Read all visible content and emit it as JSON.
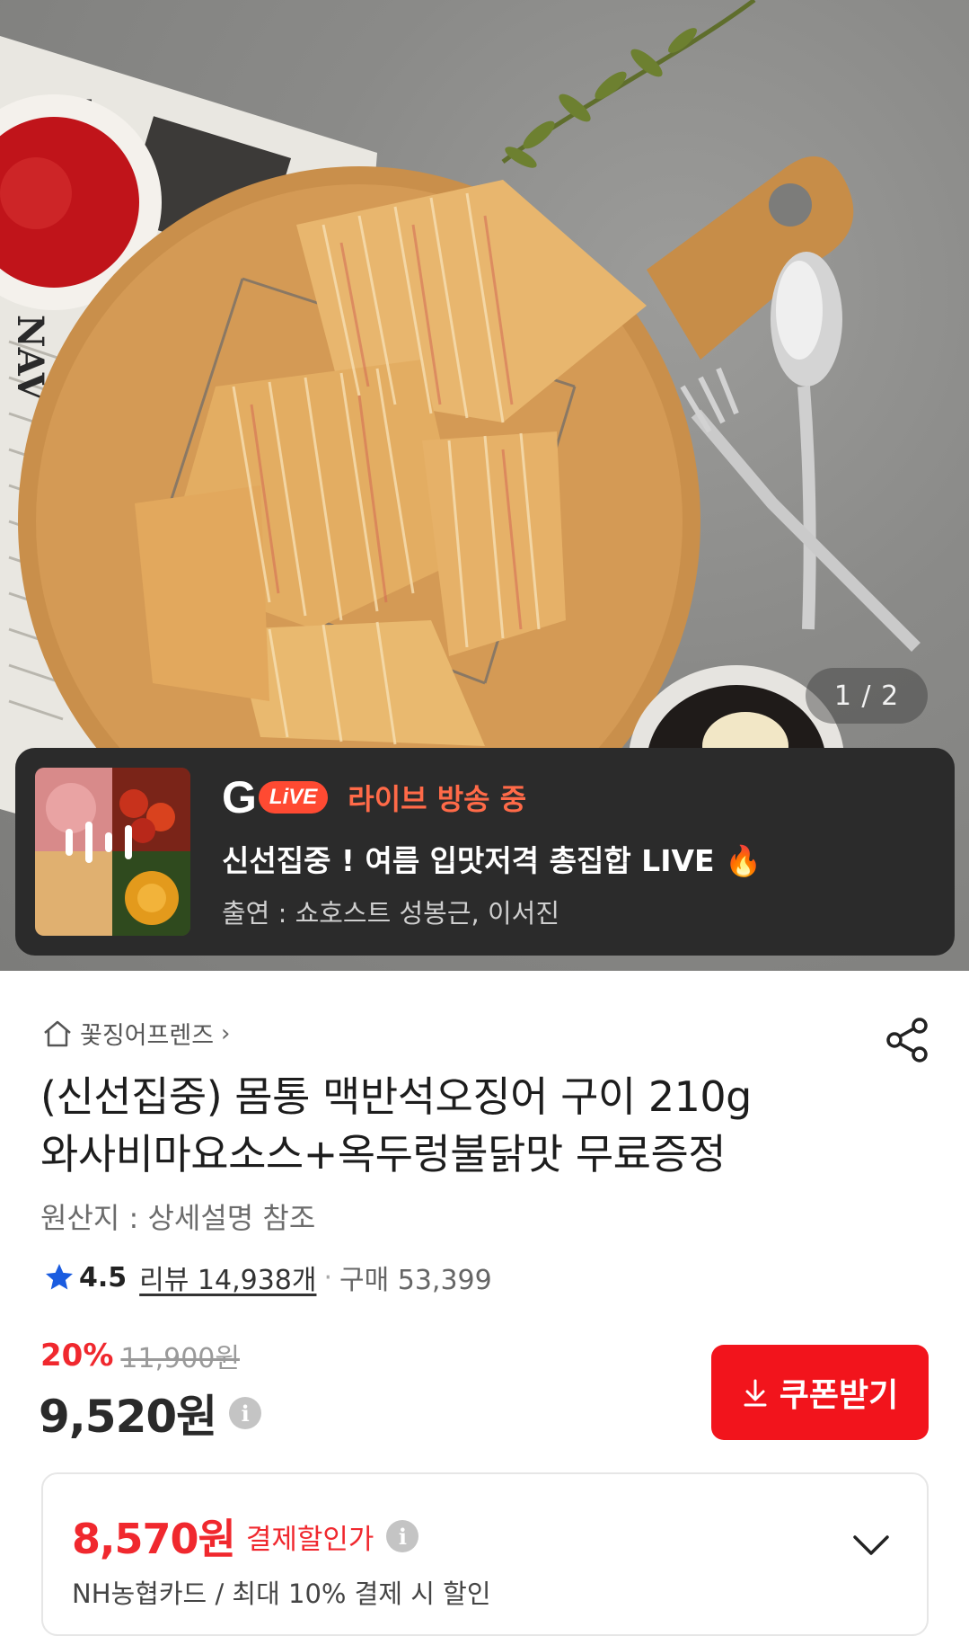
{
  "image_counter": "1 / 2",
  "live": {
    "logo_g": "G",
    "logo_live": "LiVE",
    "status": "라이브 방송 중",
    "title": "신선집중 ! 여름 입맛저격 총집합 LIVE",
    "title_emoji": "🔥",
    "cast": "출연 : 쇼호스트 성봉근, 이서진"
  },
  "product": {
    "store_name": "꽃징어프렌즈",
    "title_line1": "(신선집중) 몸통 맥반석오징어 구이 210g",
    "title_line2": "와사비마요소스+옥두렁불닭맛 무료증정",
    "origin": "원산지 : 상세설명 참조",
    "rating": "4.5",
    "reviews": "리뷰 14,938개",
    "purchases": "구매 53,399",
    "discount": "20%",
    "original_price": "11,900원",
    "price": "9,520원",
    "coupon_button": "쿠폰받기"
  },
  "payment": {
    "price": "8,570원",
    "label": "결제할인가",
    "sub": "NH농협카드 / 최대 10% 결제 시 할인"
  },
  "colors": {
    "accent_red": "#f2141c",
    "live_orange": "#ff6a48",
    "banner_bg": "#2b2b2b",
    "star_blue": "#1a5ce0"
  }
}
